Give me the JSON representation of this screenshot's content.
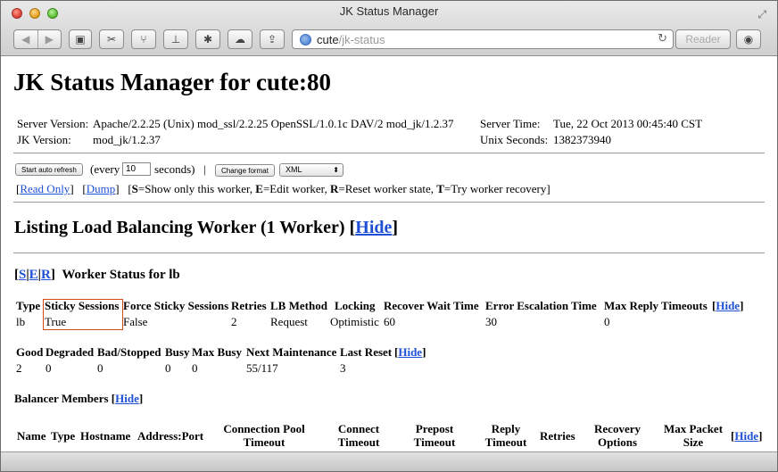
{
  "window": {
    "title": "JK Status Manager"
  },
  "toolbar": {
    "back": "◀",
    "forward": "▶",
    "url_host": "cute",
    "url_path": "/jk-status",
    "reload": "↻",
    "reader": "Reader"
  },
  "page": {
    "title": "JK Status Manager for cute:80",
    "server_version_label": "Server Version:",
    "server_version_value": "Apache/2.2.25 (Unix) mod_ssl/2.2.25 OpenSSL/1.0.1c DAV/2 mod_jk/1.2.37",
    "jk_version_label": "JK Version:",
    "jk_version_value": "mod_jk/1.2.37",
    "server_time_label": "Server Time:",
    "server_time_value": "Tue, 22 Oct 2013 00:45:40 CST",
    "unix_seconds_label": "Unix Seconds:",
    "unix_seconds_value": "1382373940",
    "start_refresh_label": "Start auto refresh",
    "every_label": "(every",
    "refresh_value": "10",
    "seconds_label": "seconds)",
    "pipe": "|",
    "change_format_label": "Change format",
    "format_value": "XML",
    "read_only_link": "Read Only",
    "dump_link": "Dump",
    "legend": {
      "s_key": "S",
      "s_text": "=Show only this worker, ",
      "e_key": "E",
      "e_text": "=Edit worker, ",
      "r_key": "R",
      "r_text": "=Reset worker state, ",
      "t_key": "T",
      "t_text": "=Try worker recovery"
    },
    "lb_heading": "Listing Load Balancing Worker (1 Worker)",
    "hide_label": "Hide",
    "worker_links": [
      "S",
      "E",
      "R"
    ],
    "worker_status_title": "Worker Status for lb",
    "lb_table": {
      "headers": [
        "Type",
        "Sticky Sessions",
        "Force Sticky Sessions",
        "Retries",
        "LB Method",
        "Locking",
        "Recover Wait Time",
        "Error Escalation Time",
        "Max Reply Timeouts"
      ],
      "row": [
        "lb",
        "True",
        "False",
        "2",
        "Request",
        "Optimistic",
        "60",
        "30",
        "0"
      ]
    },
    "state_table": {
      "headers": [
        "Good",
        "Degraded",
        "Bad/Stopped",
        "Busy",
        "Max Busy",
        "Next Maintenance",
        "Last Reset"
      ],
      "row": [
        "2",
        "0",
        "0",
        "0",
        "0",
        "55/117",
        "3"
      ]
    },
    "balancer_members_title": "Balancer Members",
    "members_headers": [
      "Name",
      "Type",
      "Hostname",
      "Address:Port",
      "Connection Pool Timeout",
      "Connect Timeout",
      "Prepost Timeout",
      "Reply Timeout",
      "Retries",
      "Recovery Options",
      "Max Packet Size"
    ]
  }
}
